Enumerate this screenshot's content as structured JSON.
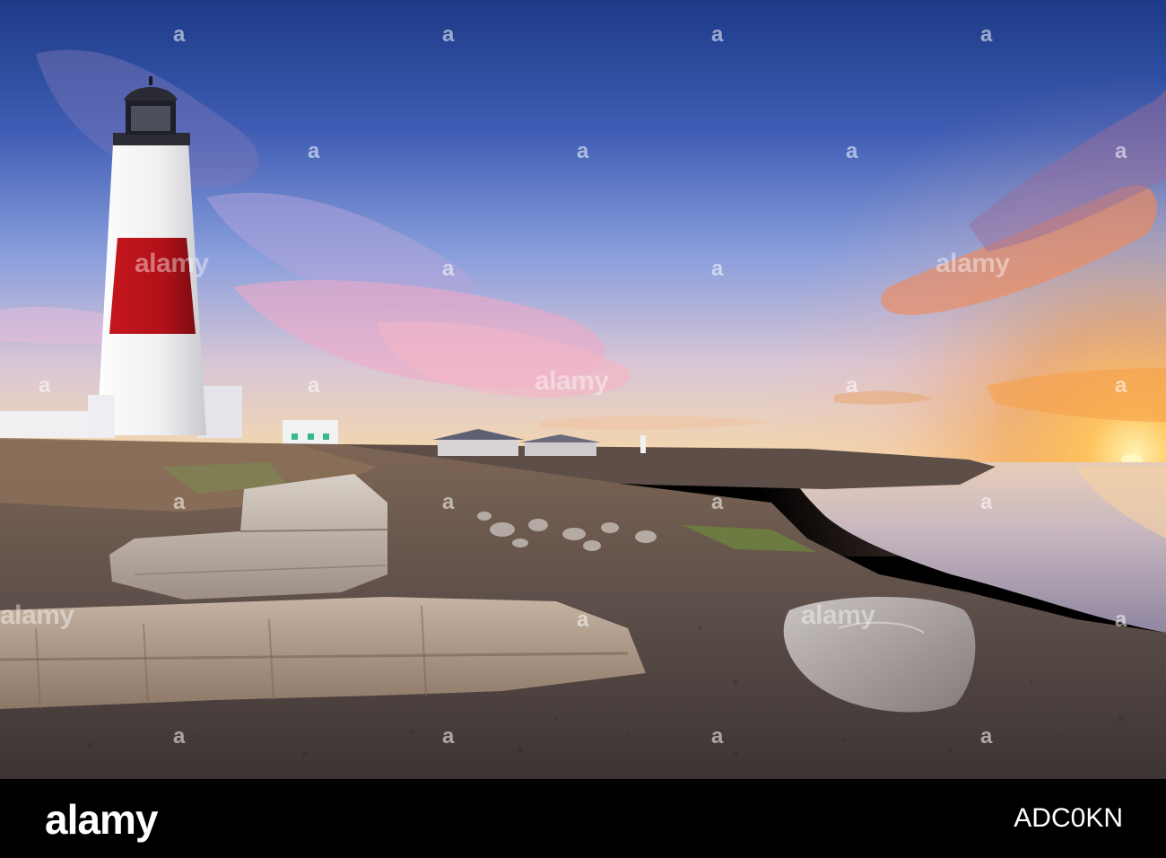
{
  "watermark": {
    "brand": "alamy",
    "tick_glyph": "a"
  },
  "footer": {
    "brand": "alamy",
    "image_id": "ADC0KN"
  },
  "colors": {
    "sky_top": "#1f3f8c",
    "sky_mid": "#7a8fd0",
    "sunset_orange": "#f5a23c",
    "lighthouse_red": "#b31218",
    "lighthouse_white": "#f4f4f4",
    "sea": "#c9b9c2",
    "rock": "#6a5a52"
  }
}
